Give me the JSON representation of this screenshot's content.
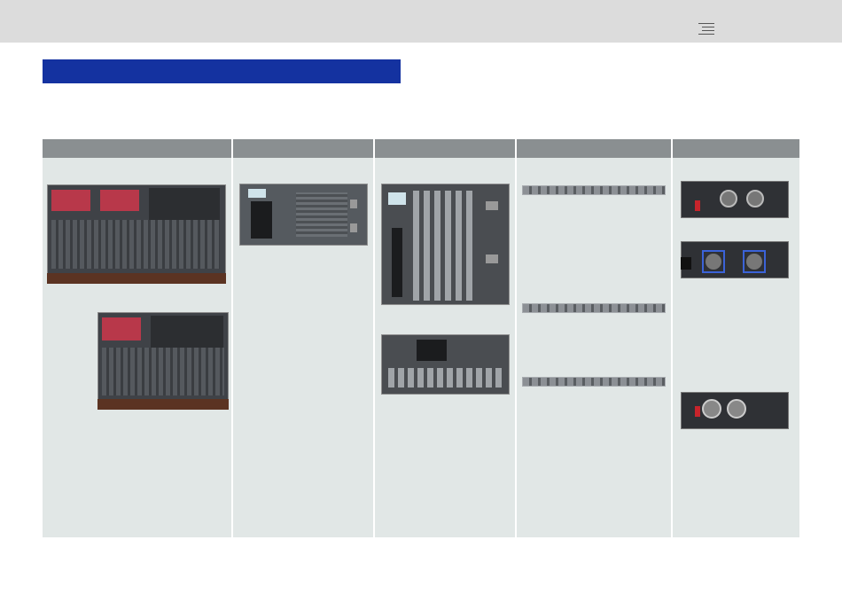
{
  "header": {
    "menu_icon": "hamburger-menu-icon"
  },
  "banner": {
    "color": "#1432a0"
  },
  "columns": [
    {
      "id": "console",
      "images": [
        "console-large",
        "console-small"
      ]
    },
    {
      "id": "dsp-engine",
      "images": [
        "dsp-engine-unit"
      ]
    },
    {
      "id": "io-rack",
      "images": [
        "io-rack-large",
        "io-rack-small"
      ]
    },
    {
      "id": "stagebox",
      "images": [
        "xlr-strip-1",
        "xlr-strip-2",
        "xlr-strip-3"
      ]
    },
    {
      "id": "interface-cards",
      "images": [
        "card-optical-1",
        "card-optical-2",
        "card-twinlan"
      ]
    }
  ],
  "colors": {
    "header_band": "#8a8f91",
    "column_bg": "#e1e7e6",
    "topbar": "#dcdcdc"
  }
}
